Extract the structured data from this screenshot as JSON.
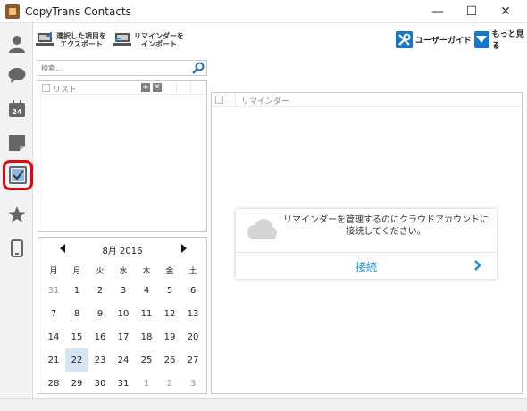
{
  "window": {
    "title": "CopyTrans Contacts",
    "controls": {
      "minimize": "—",
      "maximize": "☐",
      "close": "✕"
    }
  },
  "sidebar": {
    "items": [
      {
        "name": "contacts",
        "icon": "person-icon"
      },
      {
        "name": "messages",
        "icon": "speech-bubble-icon"
      },
      {
        "name": "calendar",
        "icon": "calendar-icon",
        "badge": "24"
      },
      {
        "name": "notes",
        "icon": "note-icon"
      },
      {
        "name": "reminders",
        "icon": "checkbox-icon",
        "active": true
      },
      {
        "name": "favorites",
        "icon": "star-icon"
      },
      {
        "name": "device",
        "icon": "phone-icon"
      }
    ],
    "active_color": "#e30613"
  },
  "toolbar": {
    "export_label_1": "選択した項目を",
    "export_label_2": "エクスポート",
    "import_label_1": "リマインダーを",
    "import_label_2": "インポート",
    "guide_label": "ユーザーガイド",
    "more_label": "もっと見る"
  },
  "search": {
    "placeholder": "検索..."
  },
  "lists": {
    "header": "リスト",
    "add": "+",
    "remove": "✕"
  },
  "calendar": {
    "month_label": "8月 2016",
    "weekdays": [
      "月",
      "火",
      "水",
      "木",
      "金",
      "土"
    ],
    "weekday_first": "月",
    "rows": [
      [
        "31",
        "1",
        "2",
        "3",
        "4",
        "5",
        "6"
      ],
      [
        "7",
        "8",
        "9",
        "10",
        "11",
        "12",
        "13"
      ],
      [
        "14",
        "15",
        "16",
        "17",
        "18",
        "19",
        "20"
      ],
      [
        "21",
        "22",
        "23",
        "24",
        "25",
        "26",
        "27"
      ],
      [
        "28",
        "29",
        "30",
        "31",
        "1",
        "2",
        "3"
      ]
    ],
    "selected": "22"
  },
  "reminders": {
    "header": "リマインダー",
    "connect_message": "リマインダーを管理するのにクラウドアカウントに接続してください。",
    "connect_button": "接続"
  },
  "colors": {
    "accent": "#1777c9",
    "link": "#1a8fd9",
    "selected_day": "#d6e4f3"
  }
}
